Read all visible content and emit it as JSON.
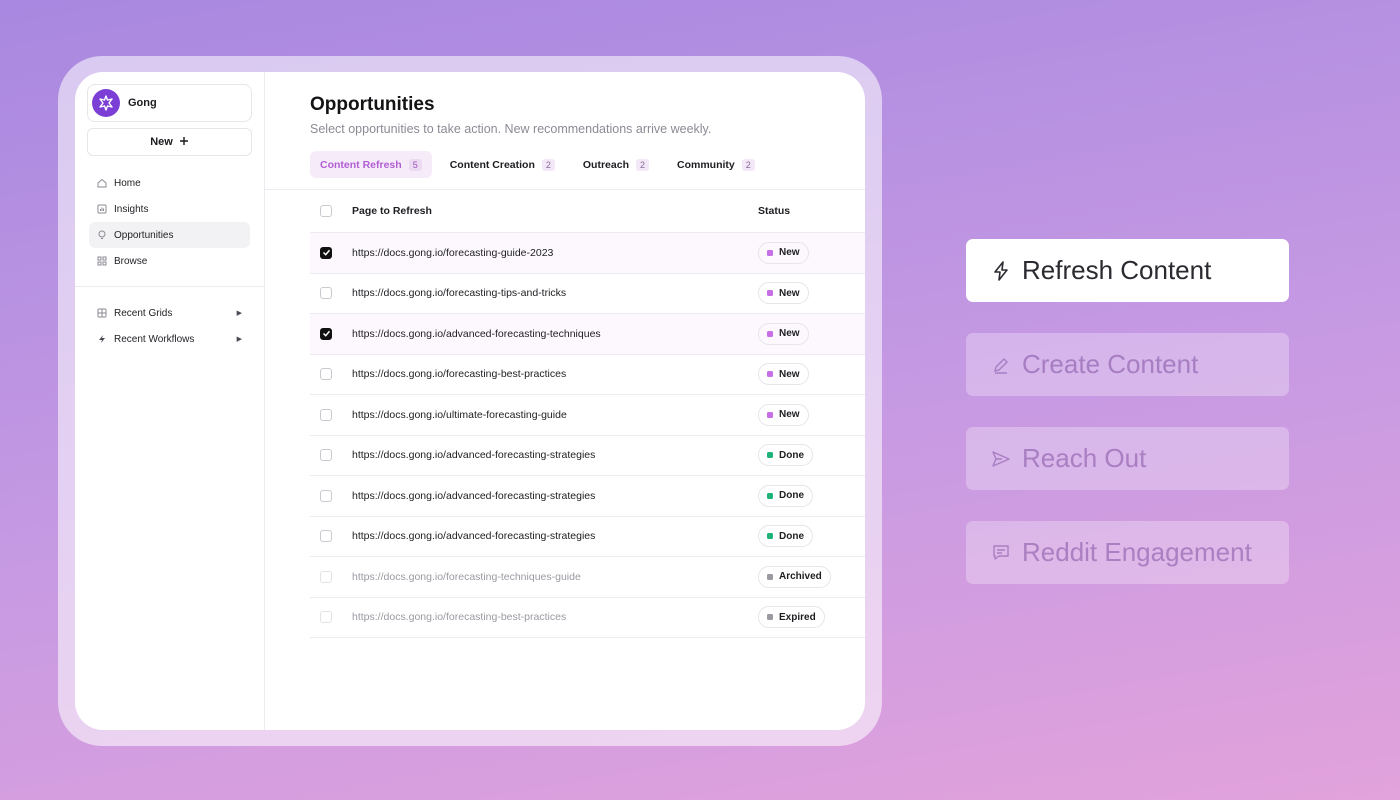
{
  "workspace": {
    "name": "Gong"
  },
  "sidebar": {
    "new_label": "New",
    "items": [
      {
        "label": "Home",
        "icon": "home-icon"
      },
      {
        "label": "Insights",
        "icon": "chart-icon"
      },
      {
        "label": "Opportunities",
        "icon": "lightbulb-icon",
        "active": true
      },
      {
        "label": "Browse",
        "icon": "grid-icon"
      }
    ],
    "recent": [
      {
        "label": "Recent Grids",
        "icon": "table-icon"
      },
      {
        "label": "Recent Workflows",
        "icon": "bolt-icon"
      }
    ]
  },
  "main": {
    "title": "Opportunities",
    "subtitle": "Select opportunities to take action. New recommendations arrive weekly.",
    "tabs": [
      {
        "label": "Content Refresh",
        "count": "5",
        "active": true
      },
      {
        "label": "Content Creation",
        "count": "2"
      },
      {
        "label": "Outreach",
        "count": "2"
      },
      {
        "label": "Community",
        "count": "2"
      }
    ],
    "table": {
      "col_page": "Page to Refresh",
      "col_status": "Status",
      "rows": [
        {
          "url": "https://docs.gong.io/forecasting-guide-2023",
          "status": "New",
          "checked": true
        },
        {
          "url": "https://docs.gong.io/forecasting-tips-and-tricks",
          "status": "New",
          "checked": false
        },
        {
          "url": "https://docs.gong.io/advanced-forecasting-techniques",
          "status": "New",
          "checked": true
        },
        {
          "url": "https://docs.gong.io/forecasting-best-practices",
          "status": "New",
          "checked": false
        },
        {
          "url": "https://docs.gong.io/ultimate-forecasting-guide",
          "status": "New",
          "checked": false
        },
        {
          "url": "https://docs.gong.io/advanced-forecasting-strategies",
          "status": "Done",
          "checked": false
        },
        {
          "url": "https://docs.gong.io/advanced-forecasting-strategies",
          "status": "Done",
          "checked": false
        },
        {
          "url": "https://docs.gong.io/advanced-forecasting-strategies",
          "status": "Done",
          "checked": false
        },
        {
          "url": "https://docs.gong.io/forecasting-techniques-guide",
          "status": "Archived",
          "checked": false
        },
        {
          "url": "https://docs.gong.io/forecasting-best-practices",
          "status": "Expired",
          "checked": false
        }
      ]
    }
  },
  "status_colors": {
    "New": "#c86ee6",
    "Done": "#1fb37a",
    "Archived": "#9a9aa2",
    "Expired": "#9a9aa2"
  },
  "actions": [
    {
      "label": "Refresh Content",
      "icon": "bolt-outline-icon",
      "primary": true
    },
    {
      "label": "Create Content",
      "icon": "pencil-icon"
    },
    {
      "label": "Reach Out",
      "icon": "send-icon"
    },
    {
      "label": "Reddit Engagement",
      "icon": "message-icon"
    }
  ]
}
